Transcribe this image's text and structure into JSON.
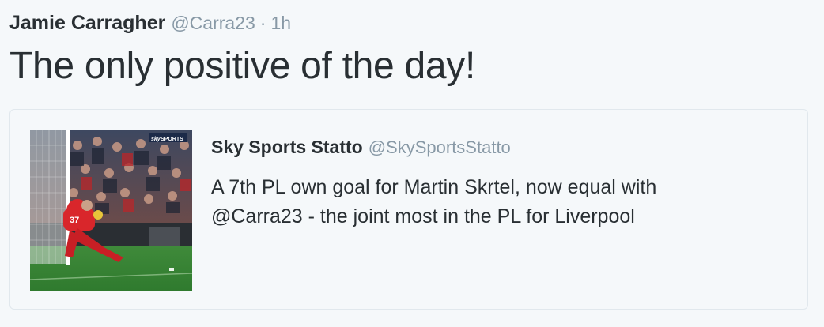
{
  "tweet": {
    "author_name": "Jamie Carragher",
    "author_handle": "@Carra23",
    "separator": "·",
    "timestamp": "1h",
    "text": "The only positive of the day!"
  },
  "quoted_tweet": {
    "author_name": "Sky Sports Statto",
    "author_handle": "@SkySportsStatto",
    "text_line1": "A 7th PL own goal for Martin Skrtel, now equal with",
    "text_line2": "@Carra23 - the joint most in the PL for Liverpool",
    "media": {
      "description_icon": "video-thumbnail-icon",
      "broadcaster_logo": "SPORTS",
      "broadcaster_prefix": "sky",
      "player_number": "37"
    }
  },
  "colors": {
    "background": "#f5f8fa",
    "text_primary": "#292f33",
    "text_secondary": "#8899a6",
    "card_border": "#e1e8ed"
  }
}
